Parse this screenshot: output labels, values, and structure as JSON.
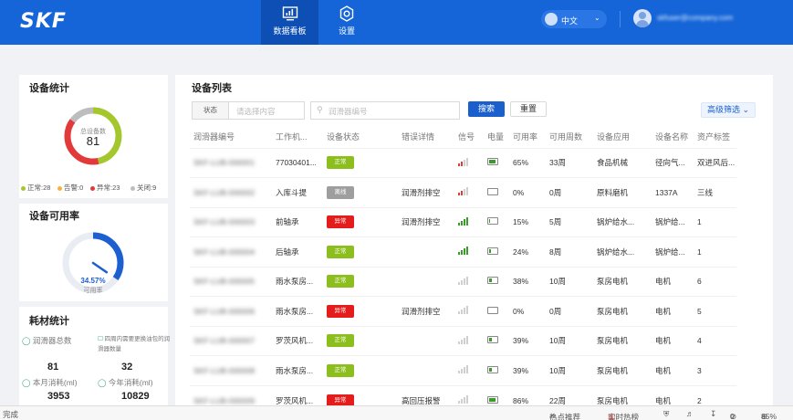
{
  "header": {
    "logo": "SKF",
    "nav": [
      {
        "label": "数据看板",
        "icon": "monitor-chart-icon",
        "active": true
      },
      {
        "label": "设置",
        "icon": "gear-icon",
        "active": false
      }
    ],
    "language": "中文",
    "user_email": "skfuser@company.com"
  },
  "device_stats": {
    "title": "设备统计",
    "center_label": "总设备数",
    "total": "81",
    "counts": {
      "normal": 28,
      "warning": 0,
      "error": 23,
      "off": 9
    },
    "legend": [
      {
        "label": "正常:28",
        "color": "#a3c72c"
      },
      {
        "label": "告警:0",
        "color": "#f3b33d"
      },
      {
        "label": "异常:23",
        "color": "#e23a3a"
      },
      {
        "label": "关闭:9",
        "color": "#bdbdbd"
      }
    ]
  },
  "availability": {
    "title": "设备可用率",
    "percent": 34.57,
    "value": "34.57%",
    "label": "可用率"
  },
  "consumables": {
    "title": "耗材统计",
    "items": [
      {
        "label": "润滑器总数",
        "value": "81",
        "icon": "drop-icon"
      },
      {
        "label": "四周内需要更换油包的润滑器数量",
        "value": "32",
        "icon": "box-icon"
      },
      {
        "label": "本月消耗(ml)",
        "value": "3953",
        "icon": "drop-icon"
      },
      {
        "label": "今年消耗(ml)",
        "value": "10829",
        "icon": "drop-icon"
      }
    ]
  },
  "device_list": {
    "title": "设备列表",
    "status_filter_label": "状态",
    "status_filter_placeholder": "请选择内容",
    "search_placeholder": "润滑器编号",
    "search_button": "搜索",
    "reset_button": "重置",
    "advanced_filter": "高级筛选",
    "columns": [
      "润滑器编号",
      "工作机...",
      "设备状态",
      "错误详情",
      "信号",
      "电量",
      "可用率",
      "可用周数",
      "设备应用",
      "设备名称",
      "资产标签"
    ],
    "rows": [
      {
        "id": "SKF-LUB-000001",
        "machine": "77030401...",
        "status": "正常",
        "status_color": "#8cbf1e",
        "error": "",
        "signal": 2,
        "signal_color": "#e23a3a",
        "battery": 0.9,
        "availability": "65%",
        "weeks": "33周",
        "application": "食品机械",
        "name": "径向气...",
        "asset": "双进风后..."
      },
      {
        "id": "SKF-LUB-000002",
        "machine": "入库斗提",
        "status": "离线",
        "status_color": "#9e9e9e",
        "error": "润滑剂排空",
        "signal": 2,
        "signal_color": "#e23a3a",
        "battery": 0.1,
        "availability": "0%",
        "weeks": "0周",
        "application": "原料磨机",
        "name": "1337A",
        "asset": "三线"
      },
      {
        "id": "SKF-LUB-000003",
        "machine": "前轴承",
        "status": "异常",
        "status_color": "#e51c1c",
        "error": "润滑剂排空",
        "signal": 4,
        "signal_color": "#3a9a2a",
        "battery": 0.15,
        "availability": "15%",
        "weeks": "5周",
        "application": "锅炉给水...",
        "name": "锅炉给...",
        "asset": "1"
      },
      {
        "id": "SKF-LUB-000004",
        "machine": "后轴承",
        "status": "正常",
        "status_color": "#8cbf1e",
        "error": "",
        "signal": 4,
        "signal_color": "#3a9a2a",
        "battery": 0.25,
        "availability": "24%",
        "weeks": "8周",
        "application": "锅炉给水...",
        "name": "锅炉给...",
        "asset": "1"
      },
      {
        "id": "SKF-LUB-000005",
        "machine": "雨水泵房...",
        "status": "正常",
        "status_color": "#8cbf1e",
        "error": "",
        "signal": 0,
        "signal_color": "#3a9a2a",
        "battery": 0.4,
        "availability": "38%",
        "weeks": "10周",
        "application": "泵房电机",
        "name": "电机",
        "asset": "6"
      },
      {
        "id": "SKF-LUB-000006",
        "machine": "雨水泵房...",
        "status": "异常",
        "status_color": "#e51c1c",
        "error": "润滑剂排空",
        "signal": 0,
        "signal_color": "#3a9a2a",
        "battery": 0.1,
        "availability": "0%",
        "weeks": "0周",
        "application": "泵房电机",
        "name": "电机",
        "asset": "5"
      },
      {
        "id": "SKF-LUB-000007",
        "machine": "罗茨风机...",
        "status": "正常",
        "status_color": "#8cbf1e",
        "error": "",
        "signal": 0,
        "signal_color": "#3a9a2a",
        "battery": 0.4,
        "availability": "39%",
        "weeks": "10周",
        "application": "泵房电机",
        "name": "电机",
        "asset": "4"
      },
      {
        "id": "SKF-LUB-000008",
        "machine": "雨水泵房...",
        "status": "正常",
        "status_color": "#8cbf1e",
        "error": "",
        "signal": 0,
        "signal_color": "#3a9a2a",
        "battery": 0.4,
        "availability": "39%",
        "weeks": "10周",
        "application": "泵房电机",
        "name": "电机",
        "asset": "3"
      },
      {
        "id": "SKF-LUB-000009",
        "machine": "罗茨风机...",
        "status": "异常",
        "status_color": "#e51c1c",
        "error": "高回压报警",
        "signal": 0,
        "signal_color": "#3a9a2a",
        "battery": 0.85,
        "availability": "86%",
        "weeks": "22周",
        "application": "泵房电机",
        "name": "电机",
        "asset": "2"
      }
    ]
  },
  "statusbar": {
    "left": "完成",
    "hot": "热点推荐",
    "realtime": "实时热榜",
    "count": "0",
    "zoom": "85%"
  }
}
